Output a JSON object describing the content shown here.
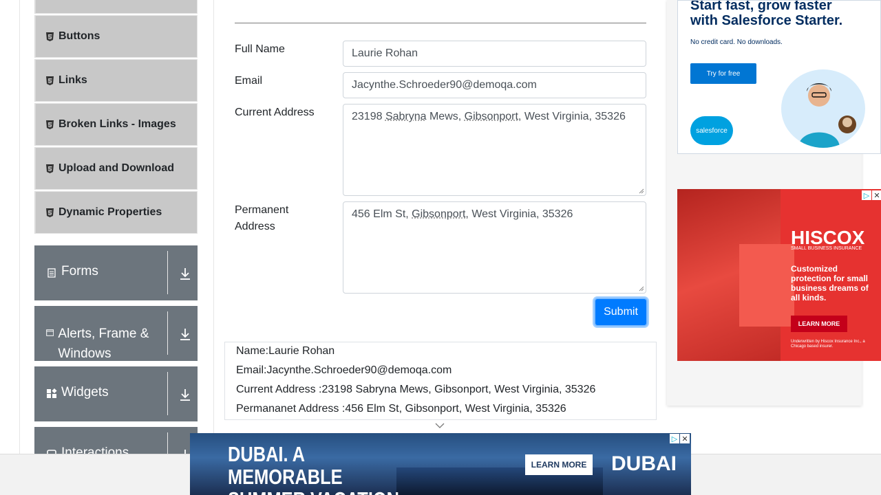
{
  "sidebar": {
    "elements_items": [
      {
        "label": "Buttons"
      },
      {
        "label": "Links"
      },
      {
        "label": "Broken Links - Images"
      },
      {
        "label": "Upload and Download"
      },
      {
        "label": "Dynamic Properties"
      }
    ],
    "groups": [
      {
        "label": "Forms",
        "icon": "forms-icon"
      },
      {
        "label": "Alerts, Frame & Windows",
        "icon": "window-icon"
      },
      {
        "label": "Widgets",
        "icon": "widgets-icon"
      },
      {
        "label": "Interactions",
        "icon": "interactions-icon"
      }
    ]
  },
  "form": {
    "full_name_label": "Full Name",
    "full_name_value": "Laurie Rohan",
    "email_label": "Email",
    "email_value": "Jacynthe.Schroeder90@demoqa.com",
    "current_address_label": "Current Address",
    "current_address": {
      "p1": "23198 ",
      "w1": "Sabryna",
      "p2": " Mews, ",
      "w2": "Gibsonport",
      "p3": ", West Virginia, 35326"
    },
    "permanent_address_label": "Permanent Address",
    "permanent_address": {
      "p1": "456 Elm St, ",
      "w1": "Gibsonport",
      "p2": ", West Virginia, 35326"
    },
    "submit_label": "Submit"
  },
  "output": {
    "name": "Name:Laurie Rohan",
    "email": "Email:Jacynthe.Schroeder90@demoqa.com",
    "current_address": "Current Address :23198 Sabryna Mews, Gibsonport, West Virginia, 35326",
    "permanent_address": "Permananet Address :456 Elm St, Gibsonport, West Virginia, 35326"
  },
  "ads": {
    "salesforce": {
      "headline": "Start fast, grow faster with Salesforce Starter.",
      "sub": "No credit card. No downloads.",
      "button": "Try for free",
      "logo": "salesforce",
      "accent": "#0176d3"
    },
    "hiscox": {
      "logo": "HISCOX",
      "tagline": "SMALL BUSINESS INSURANCE",
      "text": "Customized protection for small business dreams of all kinds.",
      "button": "LEARN MORE",
      "underwritten": "Underwritten by Hiscox Insurance Inc., a Chicago based insurer.",
      "accent": "#e63230"
    },
    "dubai": {
      "headline": "DUBAI. A MEMORABLE SUMMER VACATION",
      "button": "LEARN MORE",
      "logo": "DUBAI"
    }
  },
  "colors": {
    "primary": "#007bff",
    "sidebar_group": "#6c757d",
    "sidebar_item": "#c8c8c8"
  }
}
